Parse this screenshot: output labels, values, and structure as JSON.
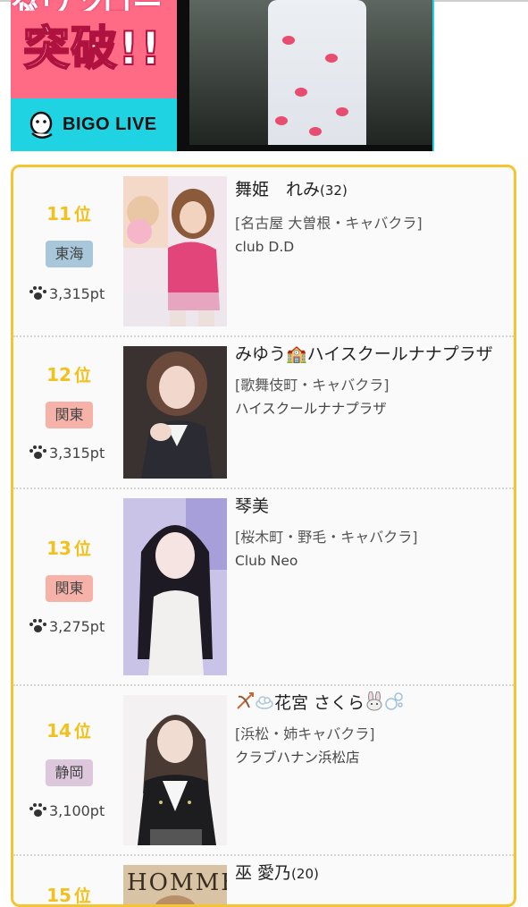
{
  "banner": {
    "top_text": "ダウンロード",
    "headline": "突破!!",
    "brand": "BIGO LIVE",
    "colors": {
      "pink": "#ff6b85",
      "cyan": "#1fd3e2"
    }
  },
  "ranking": {
    "rank_suffix": "位",
    "points_icon": "paw-icon",
    "items": [
      {
        "rank": "11",
        "region": "東海",
        "region_color": "#a9c7db",
        "points": "3,315pt",
        "name": "舞姫　れみ",
        "age": "(32)",
        "area": "[名古屋 大曽根・キャバクラ]",
        "shop": "club D.D"
      },
      {
        "rank": "12",
        "region": "関東",
        "region_color": "#f6b2a9",
        "points": "3,315pt",
        "name": "みゆう🏫ハイスクールナナプラザ",
        "name_icon": "school-icon",
        "age": "",
        "area": "[歌舞伎町・キャバクラ]",
        "shop": "ハイスクールナナプラザ"
      },
      {
        "rank": "13",
        "region": "関東",
        "region_color": "#f6b2a9",
        "points": "3,275pt",
        "name": "琴美",
        "age": "",
        "area": "[桜木町・野毛・キャバクラ]",
        "shop": "Club Neo"
      },
      {
        "rank": "14",
        "region": "静岡",
        "region_color": "#dcc7dc",
        "points": "3,100pt",
        "name": "花宮 さくら",
        "name_icons": [
          "bow-arrow-icon",
          "cloud-icon",
          "rabbit-icon",
          "bubbles-icon"
        ],
        "age": "",
        "area": "[浜松・姉キャバクラ]",
        "shop": "クラブハナン浜松店"
      },
      {
        "rank": "15",
        "region": "",
        "points": "",
        "name": "巫 愛乃",
        "age": "(20)",
        "area": "",
        "shop": ""
      }
    ]
  }
}
